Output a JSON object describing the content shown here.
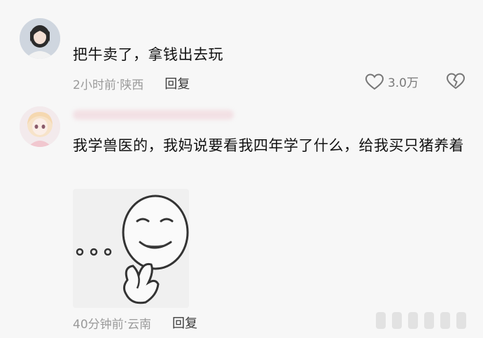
{
  "comments": [
    {
      "text": "把牛卖了，拿钱出去玩",
      "time": "2小时前",
      "location": "陕西",
      "reply_label": "回复",
      "likes": "3.0万"
    },
    {
      "text": "我学兽医的，我妈说要看我四年学了什么，给我买只猪养着",
      "time": "40分钟前",
      "location": "云南",
      "reply_label": "回复"
    }
  ],
  "meta_separator": " · ",
  "icons": {
    "like": "heart-outline-icon",
    "dislike": "broken-heart-icon"
  },
  "colors": {
    "background": "#f7f7f7",
    "meta_text": "#9a9a9a",
    "body_text": "#111111"
  }
}
